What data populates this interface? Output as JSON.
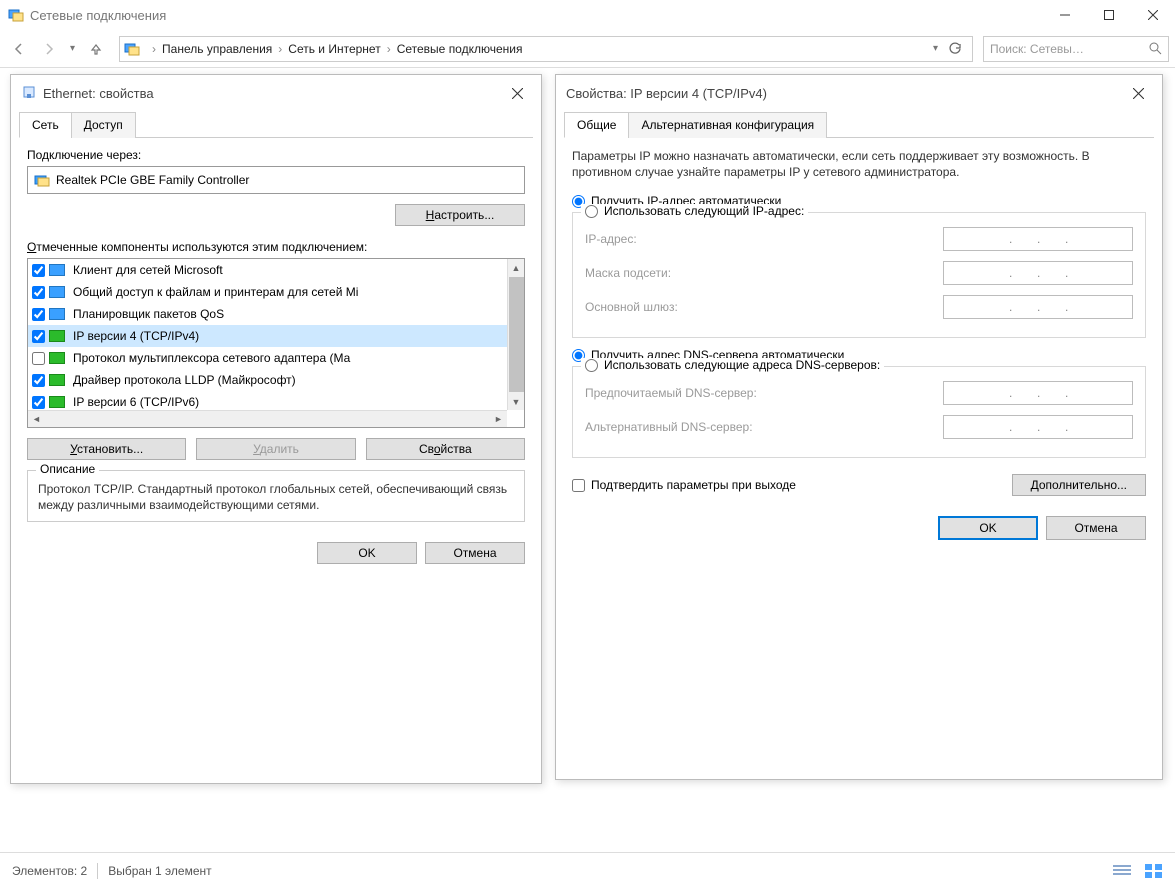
{
  "window": {
    "title": "Сетевые подключения"
  },
  "breadcrumb": {
    "items": [
      "Панель управления",
      "Сеть и Интернет",
      "Сетевые подключения"
    ]
  },
  "search": {
    "placeholder": "Поиск: Сетевы…"
  },
  "statusbar": {
    "items_label": "Элементов: 2",
    "selected_label": "Выбран 1 элемент"
  },
  "ethernet": {
    "title": "Ethernet: свойства",
    "tabs": {
      "net": "Сеть",
      "access": "Доступ"
    },
    "connect_via_label": "Подключение через:",
    "adapter": "Realtek PCIe GBE Family Controller",
    "configure_btn": "Настроить...",
    "configure_accel": "Н",
    "components_label": "Отмеченные компоненты используются этим подключением:",
    "components_accel": "О",
    "components": [
      {
        "checked": true,
        "label": "Клиент для сетей Microsoft"
      },
      {
        "checked": true,
        "label": "Общий доступ к файлам и принтерам для сетей Mi"
      },
      {
        "checked": true,
        "label": "Планировщик пакетов QoS"
      },
      {
        "checked": true,
        "label": "IP версии 4 (TCP/IPv4)",
        "selected": true
      },
      {
        "checked": false,
        "label": "Протокол мультиплексора сетевого адаптера (Ма"
      },
      {
        "checked": true,
        "label": "Драйвер протокола LLDP (Майкрософт)"
      },
      {
        "checked": true,
        "label": "IP версии 6 (TCP/IPv6)"
      }
    ],
    "install_btn": "Установить...",
    "install_accel": "У",
    "remove_btn": "Удалить",
    "remove_accel": "У",
    "props_btn": "Свойства",
    "props_accel": "о",
    "desc_legend": "Описание",
    "desc_text": "Протокол TCP/IP. Стандартный протокол глобальных сетей, обеспечивающий связь между различными взаимодействующими сетями.",
    "ok": "OK",
    "cancel": "Отмена"
  },
  "ipv4": {
    "title": "Свойства: IP версии 4 (TCP/IPv4)",
    "tabs": {
      "general": "Общие",
      "alt": "Альтернативная конфигурация"
    },
    "intro": "Параметры IP можно назначать автоматически, если сеть поддерживает эту возможность. В противном случае узнайте параметры IP у сетевого администратора.",
    "auto_ip": "Получить IP-адрес автоматически",
    "man_ip": "Использовать следующий IP-адрес:",
    "ip_label": "IP-адрес:",
    "mask_label": "Маска подсети:",
    "gw_label": "Основной шлюз:",
    "auto_dns": "Получить адрес DNS-сервера автоматически",
    "man_dns": "Использовать следующие адреса DNS-серверов:",
    "pref_dns": "Предпочитаемый DNS-сервер:",
    "alt_dns": "Альтернативный DNS-сервер:",
    "validate": "Подтвердить параметры при выходе",
    "advanced": "Дополнительно...",
    "ok": "OK",
    "cancel": "Отмена"
  }
}
